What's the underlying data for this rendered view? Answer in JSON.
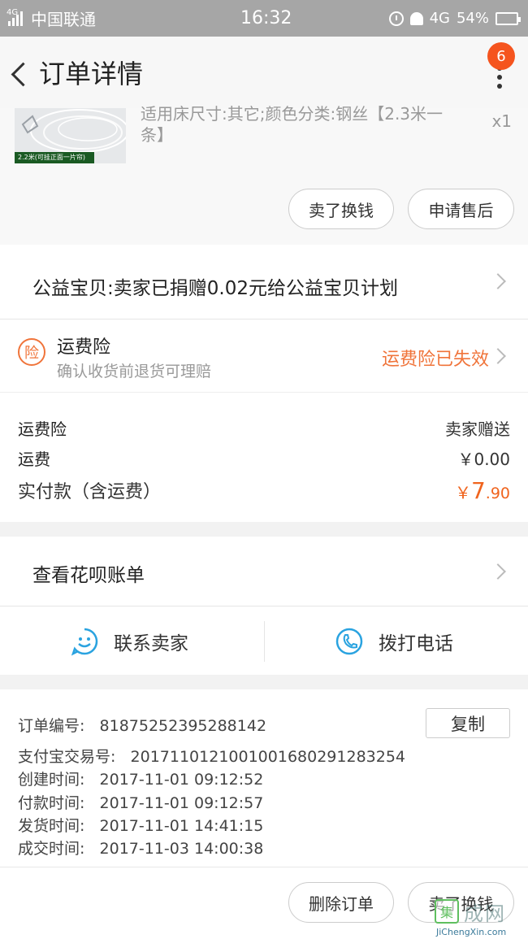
{
  "status_bar": {
    "network_small": "4G",
    "carrier": "中国联通",
    "time": "16:32",
    "network": "4G",
    "battery": "54%"
  },
  "nav": {
    "title": "订单详情",
    "badge_count": "6"
  },
  "product": {
    "thumb_label": "2.2米(可挂正面一片帘)",
    "sku": "适用床尺寸:其它;颜色分类:钢丝【2.3米一条】",
    "qty": "x1",
    "sell_button": "卖了换钱",
    "after_sale_button": "申请售后"
  },
  "charity": {
    "text": "公益宝贝:卖家已捐赠0.02元给公益宝贝计划"
  },
  "insurance": {
    "icon_char": "险",
    "title": "运费险",
    "subtitle": "确认收货前退货可理赔",
    "status": "运费险已失效"
  },
  "fees": {
    "insurance_label": "运费险",
    "insurance_value": "卖家赠送",
    "shipping_label": "运费",
    "shipping_value": "￥0.00",
    "total_label": "实付款（含运费）",
    "total_currency": "￥",
    "total_int": "7",
    "total_dec": ".90"
  },
  "huabei": {
    "text": "查看花呗账单"
  },
  "contact": {
    "seller_label": "联系卖家",
    "call_label": "拨打电话"
  },
  "order_info": {
    "order_no_label": "订单编号:",
    "order_no": "81875252395288142",
    "copy_button": "复制",
    "alipay_label": "支付宝交易号:",
    "alipay_no": "2017110121001001680291283254",
    "created_label": "创建时间:",
    "created": "2017-11-01 09:12:52",
    "paid_label": "付款时间:",
    "paid": "2017-11-01 09:12:57",
    "shipped_label": "发货时间:",
    "shipped": "2017-11-01 14:41:15",
    "completed_label": "成交时间:",
    "completed": "2017-11-03 14:00:38"
  },
  "bottom": {
    "delete_button": "删除订单",
    "sell_button": "卖了换钱"
  },
  "watermark": {
    "icon_char": "集",
    "text": "成网",
    "url": "JiChengXin.com"
  },
  "colors": {
    "accent": "#f0641e",
    "badge": "#f5541e",
    "icon_blue": "#2aa3e0"
  }
}
